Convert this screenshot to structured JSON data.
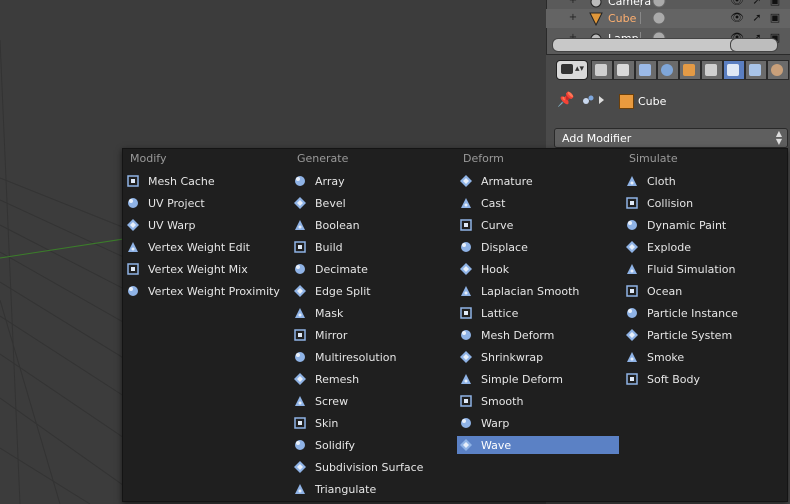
{
  "outliner": {
    "rows": [
      {
        "label": "Camera",
        "expander": "+",
        "icon": "camera-icon"
      },
      {
        "label": "Cube",
        "expander": "+",
        "icon": "mesh-cone-icon",
        "selected": true
      },
      {
        "label": "Lamp",
        "expander": "+",
        "icon": "lamp-icon"
      }
    ]
  },
  "properties": {
    "object_name": "Cube",
    "add_modifier_label": "Add Modifier",
    "tabs": [
      "render-icon",
      "layers-icon",
      "scene-icon",
      "world-icon",
      "object-icon",
      "constraints-icon",
      "modifiers-icon",
      "data-icon",
      "material-icon"
    ],
    "active_tab": "modifiers-icon"
  },
  "menu": {
    "columns": [
      {
        "heading": "Modify",
        "items": [
          "Mesh Cache",
          "UV Project",
          "UV Warp",
          "Vertex Weight Edit",
          "Vertex Weight Mix",
          "Vertex Weight Proximity"
        ]
      },
      {
        "heading": "Generate",
        "items": [
          "Array",
          "Bevel",
          "Boolean",
          "Build",
          "Decimate",
          "Edge Split",
          "Mask",
          "Mirror",
          "Multiresolution",
          "Remesh",
          "Screw",
          "Skin",
          "Solidify",
          "Subdivision Surface",
          "Triangulate"
        ]
      },
      {
        "heading": "Deform",
        "items": [
          "Armature",
          "Cast",
          "Curve",
          "Displace",
          "Hook",
          "Laplacian Smooth",
          "Lattice",
          "Mesh Deform",
          "Shrinkwrap",
          "Simple Deform",
          "Smooth",
          "Warp",
          "Wave"
        ]
      },
      {
        "heading": "Simulate",
        "items": [
          "Cloth",
          "Collision",
          "Dynamic Paint",
          "Explode",
          "Fluid Simulation",
          "Ocean",
          "Particle Instance",
          "Particle System",
          "Smoke",
          "Soft Body"
        ]
      }
    ],
    "highlighted": "Wave"
  },
  "colors": {
    "highlight": "#5b81c5",
    "menu_bg": "#1f1f1f",
    "icon_blue": "#8fb3e6"
  }
}
